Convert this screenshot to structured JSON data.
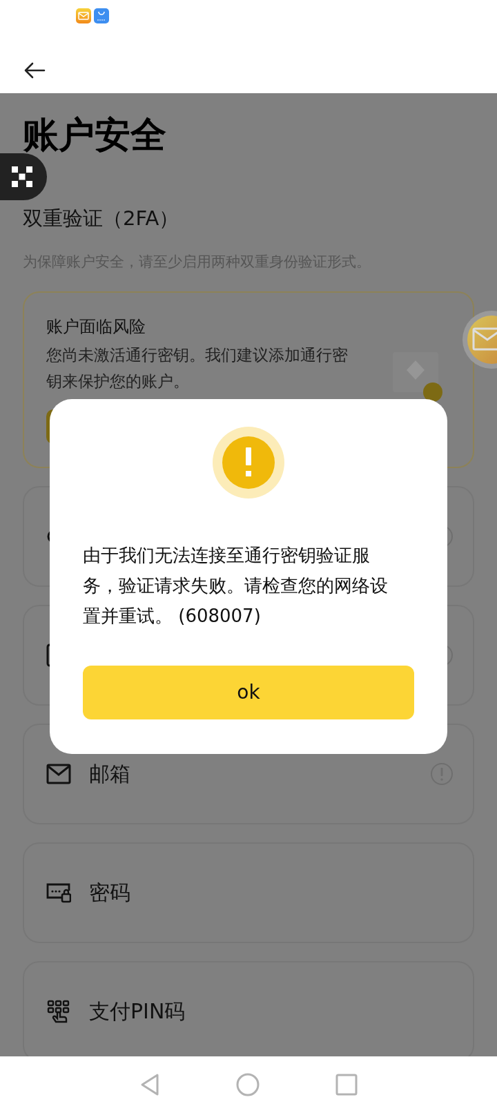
{
  "page": {
    "title": "账户安全",
    "section_title": "双重验证（2FA）",
    "section_hint": "为保障账户安全，请至少启用两种双重身份验证形式。"
  },
  "risk_card": {
    "title": "账户面临风险",
    "message": "您尚未激活通行密钥。我们建议添加通行密钥来保护您的账户。"
  },
  "methods": [
    {
      "kind": "key",
      "warning": true
    },
    {
      "kind": "phone",
      "warning": true
    },
    {
      "kind": "email",
      "label": "邮箱",
      "warning": true
    },
    {
      "kind": "password",
      "label": "密码",
      "warning": false
    },
    {
      "kind": "pin",
      "label": "支付PIN码",
      "warning": false
    }
  ],
  "dialog": {
    "message": "由于我们无法连接至通行密钥验证服务，验证请求失败。请检查您的网络设置并重试。 (608007)",
    "button": "ok"
  }
}
